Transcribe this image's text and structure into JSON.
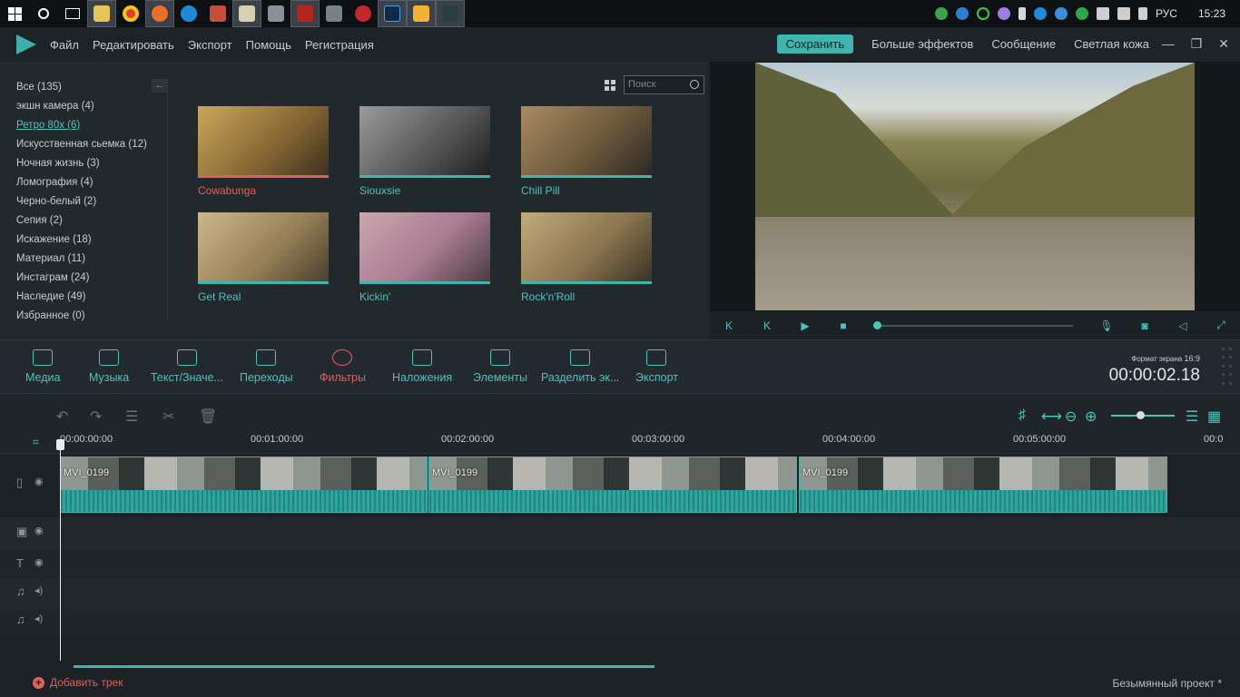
{
  "taskbar": {
    "start_icon": "windows-icon",
    "tray": {
      "language": "РУС",
      "time": "15:23"
    }
  },
  "menubar": {
    "items": [
      "Файл",
      "Редактировать",
      "Экспорт",
      "Помощь",
      "Регистрация"
    ],
    "save_label": "Сохранить",
    "right_items": [
      "Больше эффектов",
      "Сообщение",
      "Светлая кожа"
    ],
    "window_controls": [
      "—",
      "❐",
      "✕"
    ]
  },
  "library": {
    "categories": [
      "Все (135)",
      "экшн камера (4)",
      "Ретро 80х (6)",
      "Искусственная сьемка (12)",
      "Ночная жизнь (3)",
      "Ломография (4)",
      "Черно-белый (2)",
      "Сепия (2)",
      "Искажение (18)",
      "Материал (11)",
      "Инстаграм (24)",
      "Наследие (49)",
      "Избранное (0)"
    ],
    "active_category": "Ретро 80х (6)",
    "search_placeholder": "Поиск",
    "filters": [
      "Cowabunga",
      "Siouxsie",
      "Chill Pill",
      "Get Real",
      "Kickin'",
      "Rock'n'Roll"
    ],
    "selected_filter": "Cowabunga"
  },
  "toolbar": {
    "tools": [
      "Медиа",
      "Музыка",
      "Текст/Значе...",
      "Переходы",
      "Фильтры",
      "Наложения",
      "Элементы",
      "Разделить эк...",
      "Экспорт"
    ],
    "active_tool": "Фильтры",
    "ratio_label": "Формат экрана",
    "ratio_value": "16:9",
    "timecode": "00:00:02.18"
  },
  "timeline": {
    "ruler": [
      "00:00:00:00",
      "00:01:00:00",
      "00:02:00:00",
      "00:03:00:00",
      "00:04:00:00",
      "00:05:00:00",
      "00:0"
    ],
    "clip_name": "MVI_0199",
    "add_track": "Добавить трек",
    "project_name": "Безымянный проект *"
  },
  "colors": {
    "accent": "#3fb6ad",
    "active": "#e0605a"
  }
}
